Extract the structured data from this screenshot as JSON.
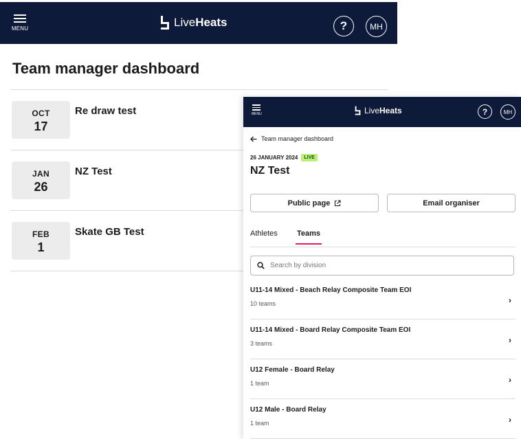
{
  "left_header": {
    "menu_label": "MENU",
    "logo_light": "Live",
    "logo_bold": "Heats",
    "help_symbol": "?",
    "avatar_initials": "MH",
    "background": "#0e1a3a"
  },
  "left_page": {
    "title": "Team manager dashboard",
    "events": [
      {
        "month": "OCT",
        "day": "17",
        "name": "Re draw test"
      },
      {
        "month": "JAN",
        "day": "26",
        "name": "NZ Test"
      },
      {
        "month": "FEB",
        "day": "1",
        "name": "Skate GB Test"
      }
    ]
  },
  "right_header": {
    "menu_label": "MENU",
    "logo_light": "Live",
    "logo_bold": "Heats",
    "help_symbol": "?",
    "avatar_initials": "MH"
  },
  "right_page": {
    "back_label": "Team manager dashboard",
    "event_date": "26 JANUARY 2024",
    "live_badge": "LIVE",
    "event_title": "NZ Test",
    "public_page_label": "Public page",
    "email_organiser_label": "Email organiser",
    "tabs": [
      {
        "label": "Athletes",
        "active": false
      },
      {
        "label": "Teams",
        "active": true
      }
    ],
    "search_placeholder": "Search by division",
    "divisions": [
      {
        "name": "U11-14 Mixed - Beach Relay Composite Team EOI",
        "count": "10 teams"
      },
      {
        "name": "U11-14 Mixed - Board Relay Composite Team EOI",
        "count": "3 teams"
      },
      {
        "name": "U12 Female - Board Relay",
        "count": "1 team"
      },
      {
        "name": "U12 Male - Board Relay",
        "count": "1 team"
      }
    ],
    "accent_color": "#e0196b",
    "live_color": "#b9f07a"
  }
}
